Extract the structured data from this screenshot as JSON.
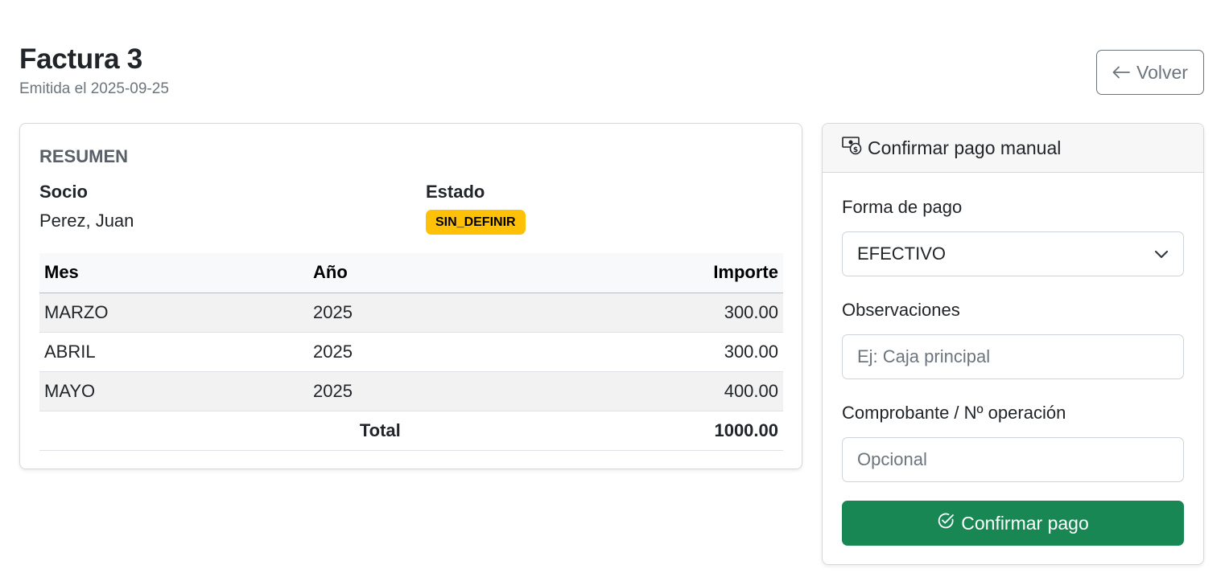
{
  "header": {
    "title": "Factura 3",
    "subtitle": "Emitida el 2025-09-25",
    "back_label": "Volver"
  },
  "summary": {
    "heading": "RESUMEN",
    "socio_label": "Socio",
    "socio_value": "Perez, Juan",
    "estado_label": "Estado",
    "estado_value": "SIN_DEFINIR",
    "badge_color": "#ffc107",
    "columns": [
      "Mes",
      "Año",
      "Importe"
    ],
    "rows": [
      {
        "mes": "MARZO",
        "anio": "2025",
        "importe": "300.00"
      },
      {
        "mes": "ABRIL",
        "anio": "2025",
        "importe": "300.00"
      },
      {
        "mes": "MAYO",
        "anio": "2025",
        "importe": "400.00"
      }
    ],
    "total_label": "Total",
    "total_value": "1000.00"
  },
  "payment": {
    "heading": "Confirmar pago manual",
    "heading_icon": "cash-coin-icon",
    "forma_label": "Forma de pago",
    "forma_value": "EFECTIVO",
    "obs_label": "Observaciones",
    "obs_placeholder": "Ej: Caja principal",
    "comp_label": "Comprobante / Nº operación",
    "comp_placeholder": "Opcional",
    "confirm_label": "Confirmar pago",
    "confirm_color": "#198754"
  }
}
